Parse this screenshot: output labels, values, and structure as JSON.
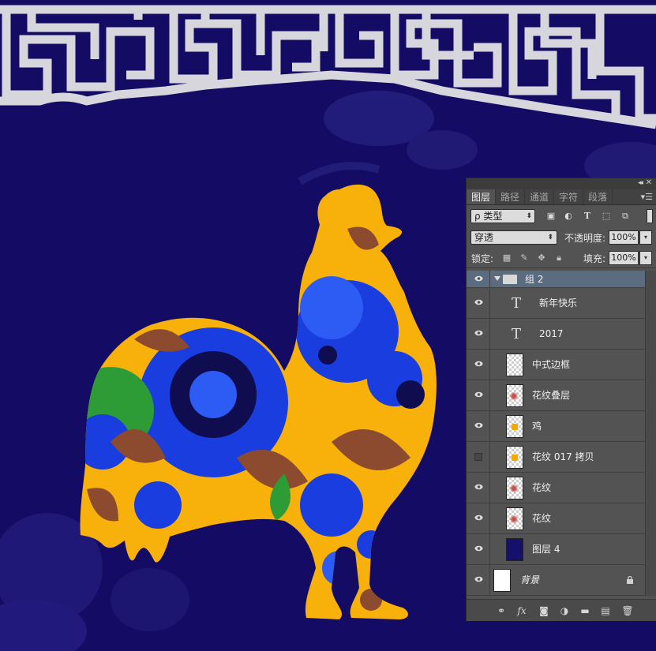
{
  "panel": {
    "tabs": [
      {
        "label": "图层",
        "active": true
      },
      {
        "label": "路径",
        "active": false
      },
      {
        "label": "通道",
        "active": false
      },
      {
        "label": "字符",
        "active": false
      },
      {
        "label": "段落",
        "active": false
      }
    ],
    "filter": {
      "label": "ρ 类型"
    },
    "blend_mode": "穿透",
    "opacity": {
      "label": "不透明度:",
      "value": "100%"
    },
    "lock_label": "锁定:",
    "fill": {
      "label": "填充:",
      "value": "100%"
    },
    "layers": [
      {
        "name": "组 2",
        "kind": "group",
        "visible": true
      },
      {
        "name": "新年快乐",
        "kind": "text",
        "visible": true
      },
      {
        "name": "2017",
        "kind": "text",
        "visible": true
      },
      {
        "name": "中式边框",
        "kind": "pixel",
        "visible": true
      },
      {
        "name": "花纹叠层",
        "kind": "pixel",
        "visible": true
      },
      {
        "name": "鸡",
        "kind": "pixel",
        "visible": true
      },
      {
        "name": "花纹 017 拷贝",
        "kind": "pixel",
        "visible": false
      },
      {
        "name": "花纹",
        "kind": "pixel",
        "visible": true
      },
      {
        "name": "花纹",
        "kind": "pixel",
        "visible": true
      },
      {
        "name": "图层 4",
        "kind": "solid",
        "visible": true
      },
      {
        "name": "背景",
        "kind": "background",
        "visible": true,
        "locked": true
      }
    ]
  },
  "colors": {
    "canvas_bg": "#140c64",
    "rooster_orange": "#f7b10a",
    "rooster_blue": "#1a3de0",
    "border_gray": "#d6d6dc",
    "panel_bg": "#535353",
    "selected_row": "#5c6c80"
  }
}
